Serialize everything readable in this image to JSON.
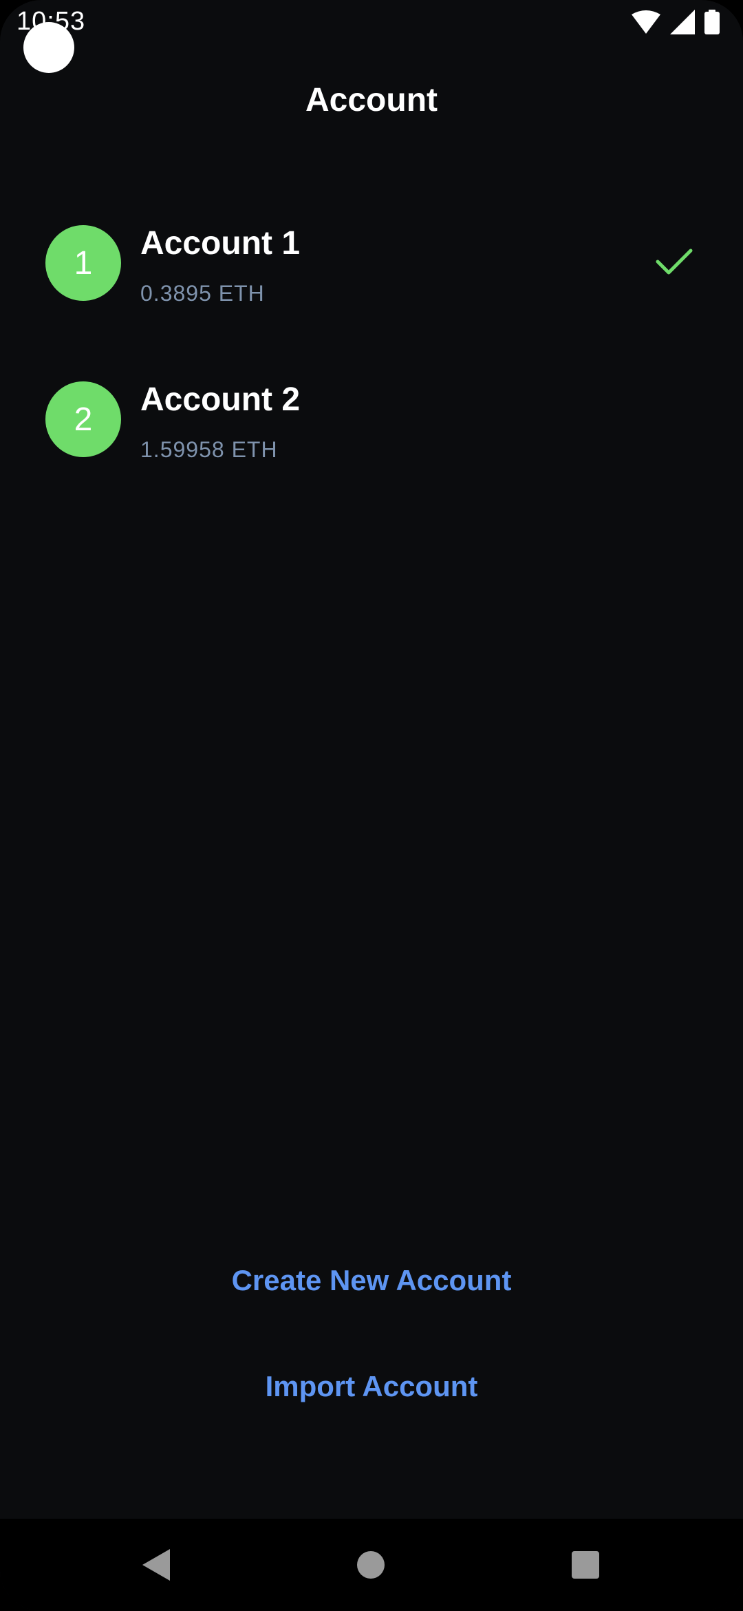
{
  "status_bar": {
    "time": "10:53",
    "icons": [
      "wifi-icon",
      "signal-icon",
      "battery-icon"
    ]
  },
  "header": {
    "title": "Account"
  },
  "accounts": [
    {
      "avatar": "1",
      "name": "Account 1",
      "balance": "0.3895 ETH",
      "selected": true
    },
    {
      "avatar": "2",
      "name": "Account 2",
      "balance": "1.59958 ETH",
      "selected": false
    }
  ],
  "actions": {
    "create_label": "Create New Account",
    "import_label": "Import Account"
  },
  "nav_bar": {
    "icons": [
      "back-icon",
      "home-icon",
      "recents-icon"
    ]
  },
  "colors": {
    "background": "#0b0c0e",
    "avatar": "#6fdc6a",
    "check": "#6fdc6a",
    "link": "#5e95f2",
    "balance_text": "#7f93ad"
  }
}
